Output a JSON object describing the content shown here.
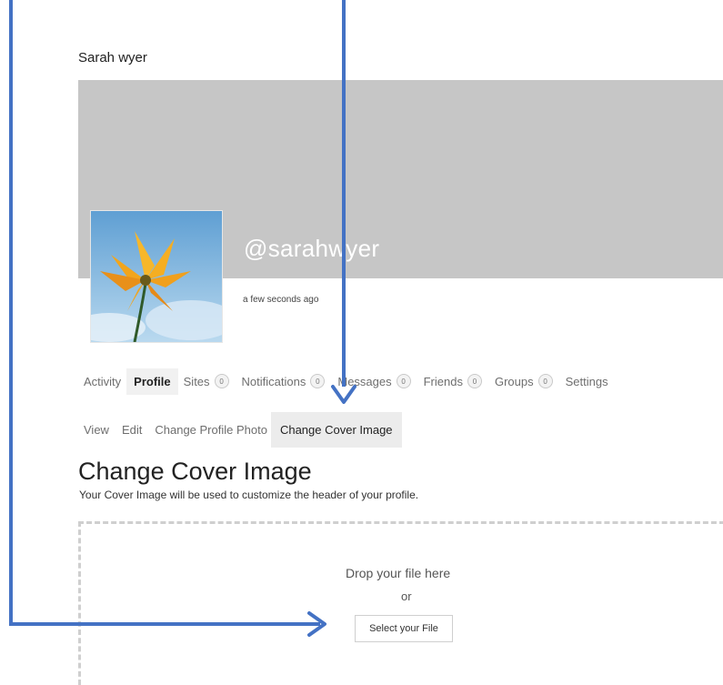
{
  "site_name": "Sarah wyer",
  "profile": {
    "handle": "@sarahwyer",
    "last_active": "a few seconds ago"
  },
  "nav": [
    {
      "label": "Activity"
    },
    {
      "label": "Profile",
      "current": true
    },
    {
      "label": "Sites",
      "count": "0"
    },
    {
      "label": "Notifications",
      "count": "0"
    },
    {
      "label": "Messages",
      "count": "0"
    },
    {
      "label": "Friends",
      "count": "0"
    },
    {
      "label": "Groups",
      "count": "0"
    },
    {
      "label": "Settings"
    }
  ],
  "subnav": [
    {
      "label": "View"
    },
    {
      "label": "Edit"
    },
    {
      "label": "Change Profile Photo"
    },
    {
      "label": "Change Cover Image",
      "current": true
    }
  ],
  "page": {
    "title": "Change Cover Image",
    "description": "Your Cover Image will be used to customize the header of your profile."
  },
  "uploader": {
    "drop_text": "Drop your file here",
    "or_text": "or",
    "select_button": "Select your File"
  },
  "colors": {
    "annotation_arrow": "#4472c4",
    "cover_background": "#c6c6c6"
  },
  "icons": {
    "avatar": "yellow-flower-photo"
  }
}
